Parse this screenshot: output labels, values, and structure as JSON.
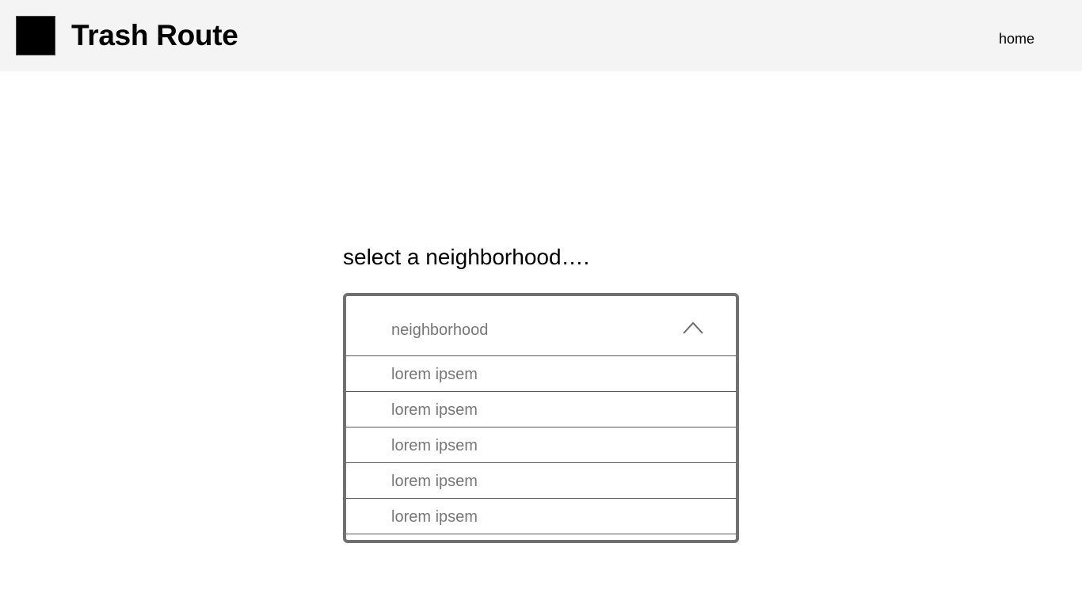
{
  "header": {
    "title": "Trash Route",
    "nav": {
      "home_label": "home"
    }
  },
  "main": {
    "prompt": "select a neighborhood….",
    "dropdown": {
      "selected_value": "neighborhood",
      "state": "open",
      "icon": "chevron-up-icon",
      "options": [
        {
          "label": "lorem ipsem"
        },
        {
          "label": "lorem ipsem"
        },
        {
          "label": "lorem ipsem"
        },
        {
          "label": "lorem ipsem"
        },
        {
          "label": "lorem ipsem"
        }
      ]
    }
  },
  "colors": {
    "header_bg": "#f4f4f4",
    "logo": "#000000",
    "dropdown_border": "#707070",
    "muted_text": "#777777"
  }
}
